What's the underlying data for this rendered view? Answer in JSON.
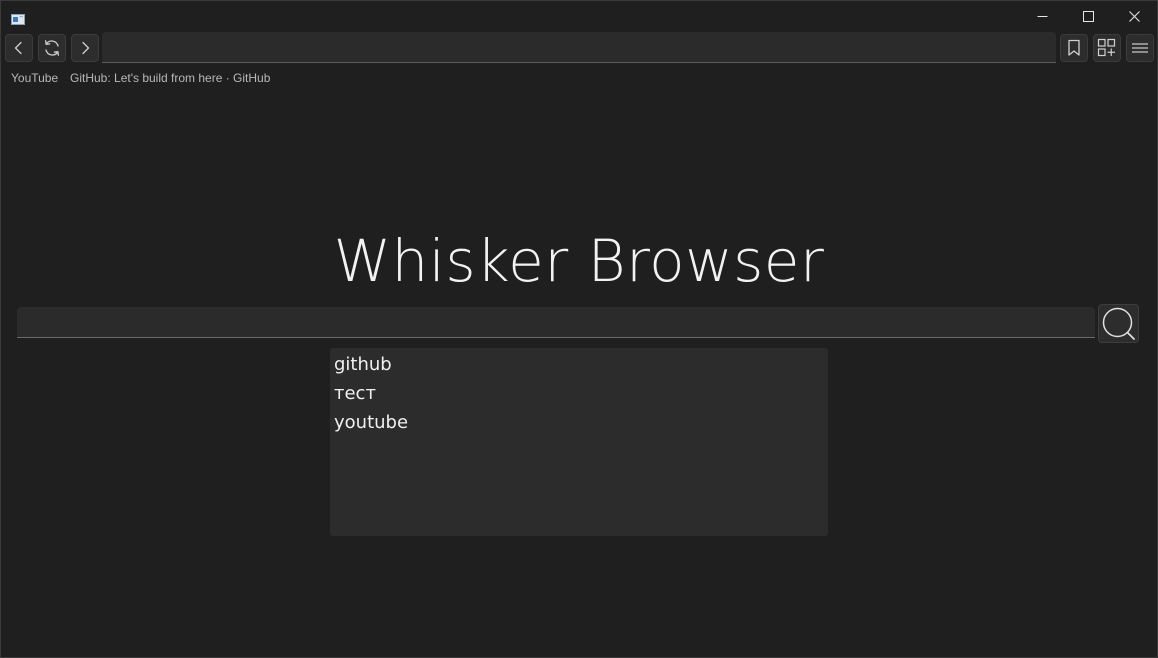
{
  "window": {
    "title_icon": "app-window-icon",
    "controls": [
      "minimize-icon",
      "maximize-icon",
      "close-icon"
    ]
  },
  "toolbar": {
    "back_icon": "chevron-left-icon",
    "reload_icon": "reload-icon",
    "forward_icon": "chevron-right-icon",
    "address_value": "",
    "bookmark_icon": "bookmark-icon",
    "extensions_icon": "extensions-icon",
    "menu_icon": "hamburger-menu-icon"
  },
  "bookmarks": [
    {
      "label": "YouTube"
    },
    {
      "label": "GitHub: Let's build from here · GitHub"
    }
  ],
  "main": {
    "title": "Whisker Browser",
    "search_value": "",
    "search_icon": "search-icon",
    "suggestions": [
      {
        "label": "github"
      },
      {
        "label": "тест"
      },
      {
        "label": "youtube"
      }
    ]
  },
  "colors": {
    "background": "#1f1f1f",
    "surface": "#2b2b2b",
    "text": "#f2f2f2",
    "muted_text": "#b8b8b8"
  }
}
